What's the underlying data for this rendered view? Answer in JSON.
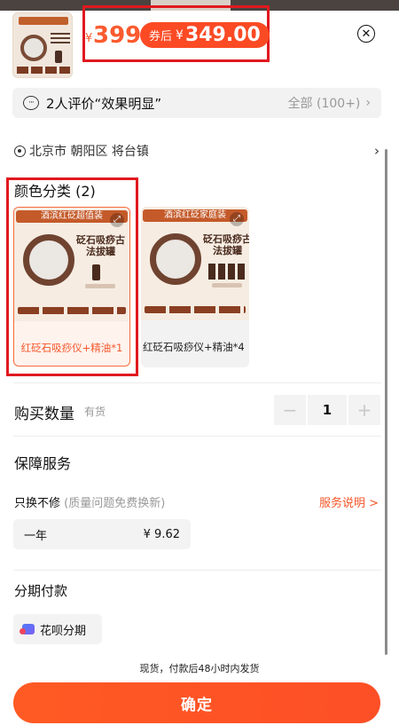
{
  "header": {
    "price_original_symbol": "¥",
    "price_original": "399",
    "after_coupon_label": "券后",
    "after_coupon_symbol": "¥",
    "after_coupon_price": "349.00",
    "close_icon": "close-icon"
  },
  "reviews": {
    "text": "2人评价“效果明显”",
    "all_label": "全部 (100+)"
  },
  "address": {
    "location": "北京市 朝阳区 将台镇"
  },
  "variants": {
    "title": "颜色分类 (2)",
    "items": [
      {
        "banner": "酒滨红砭超值装",
        "title": "砭石吸痧古法拔罐",
        "label": "红砭石吸痧仪+精油*1",
        "selected": true
      },
      {
        "banner": "酒滨红砭家庭装",
        "title": "砭石吸痧古法拔罐",
        "label": "红砭石吸痧仪+精油*4",
        "selected": false
      }
    ]
  },
  "quantity": {
    "title": "购买数量",
    "stock": "有货",
    "value": "1",
    "minus": "−",
    "plus": "+"
  },
  "guarantee": {
    "title": "保障服务",
    "name": "只换不修",
    "note": "(质量问题免费换新)",
    "link": "服务说明 >",
    "option_label": "一年",
    "option_price": "¥ 9.62"
  },
  "installment": {
    "title": "分期付款",
    "option": "花呗分期"
  },
  "footer": {
    "ship_note": "现货，付款后48小时内发货",
    "confirm": "确定"
  },
  "colors": {
    "accent": "#fb4a24",
    "highlight_box": "#e0191f",
    "muted": "#999999"
  }
}
